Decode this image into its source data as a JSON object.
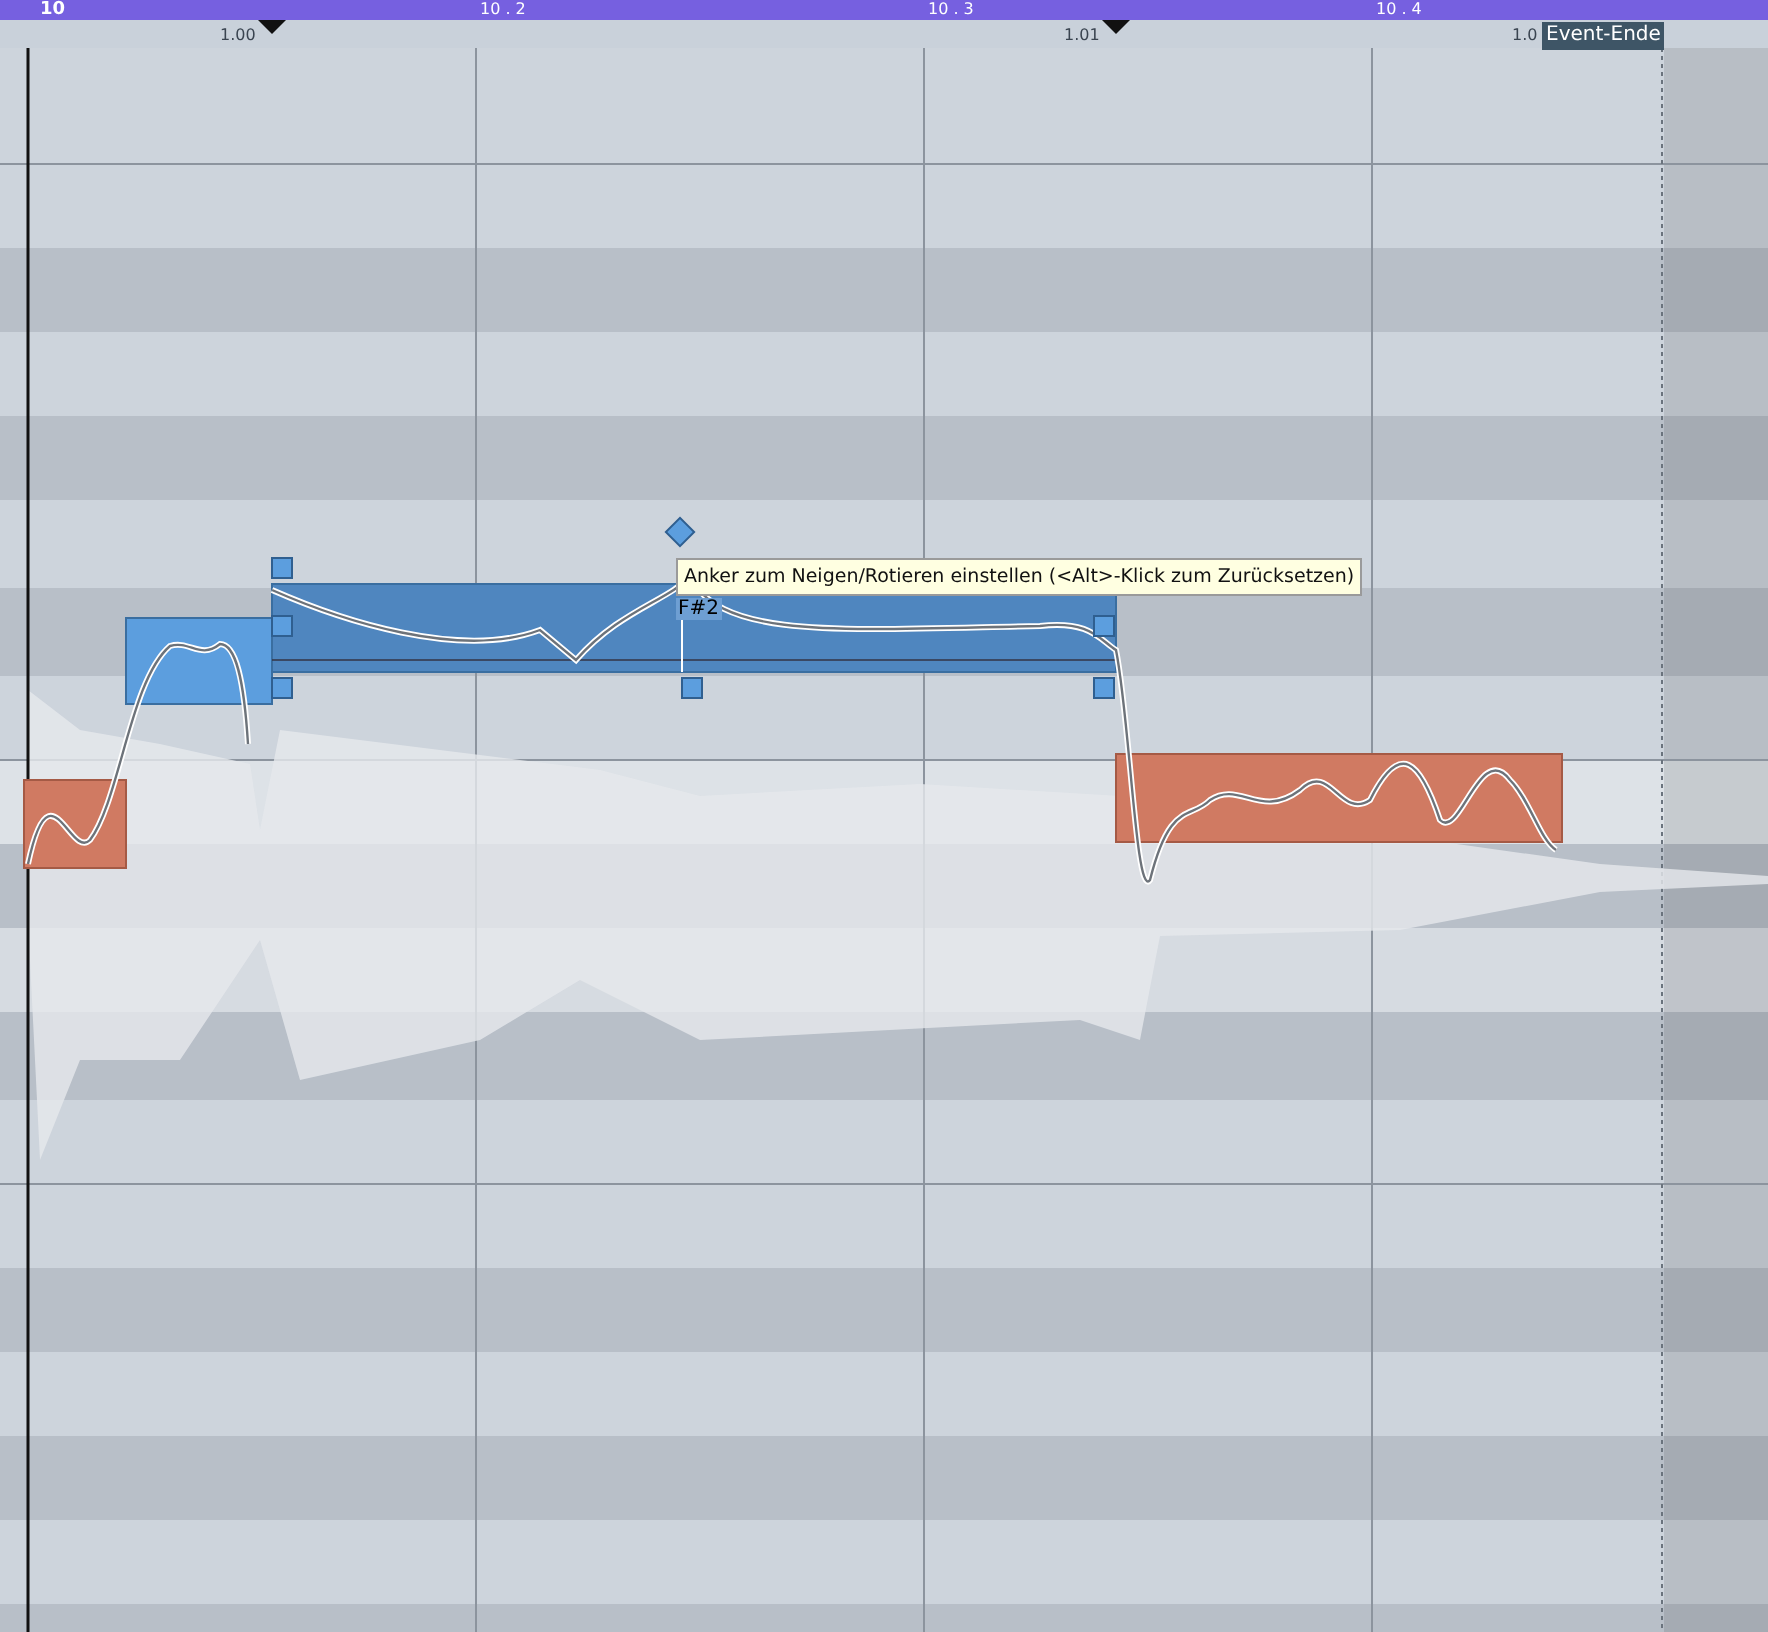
{
  "ruler": {
    "bars": [
      {
        "label": "10"
      },
      {
        "label": "10 . 2"
      },
      {
        "label": "10 . 3"
      },
      {
        "label": "10 . 4"
      }
    ],
    "markers": [
      {
        "label": "1.00"
      },
      {
        "label": "1.01"
      },
      {
        "label": "1.0"
      }
    ],
    "event_end": "Event-Ende"
  },
  "notes": [
    {
      "selected": false
    },
    {
      "selected": true
    },
    {
      "selected": true,
      "pitch": "F#2"
    },
    {
      "selected": false
    }
  ],
  "tooltip": "Anker zum Neigen/Rotieren einstellen (<Alt>-Klick zum Zurücksetzen)"
}
